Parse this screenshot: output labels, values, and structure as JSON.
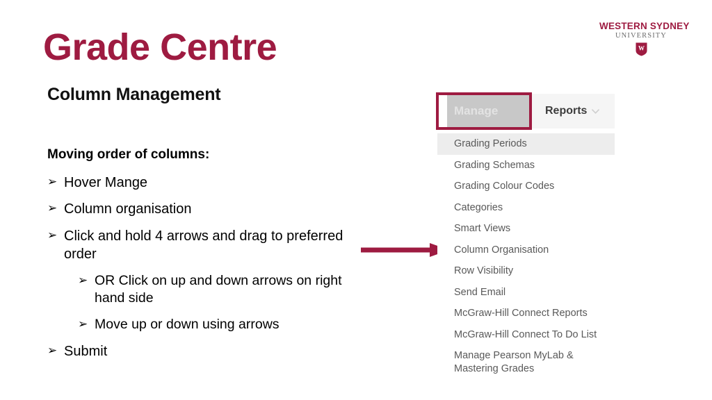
{
  "brand": {
    "line1": "WESTERN SYDNEY",
    "line2": "UNIVERSITY",
    "shield_letter": "W",
    "color": "#9E1B41"
  },
  "slide": {
    "title": "Grade Centre",
    "subtitle": "Column Management",
    "title_color": "#9E1B41"
  },
  "content": {
    "lead": "Moving order of columns:",
    "bullet_marker": "➢",
    "items": [
      {
        "level": 1,
        "text": "Hover Mange"
      },
      {
        "level": 1,
        "text": "Column organisation"
      },
      {
        "level": 1,
        "text": "Click and hold 4 arrows and drag to preferred order"
      },
      {
        "level": 2,
        "text": "OR Click on up and down arrows on right hand side"
      },
      {
        "level": 2,
        "text": " Move up or down using arrows"
      },
      {
        "level": 1,
        "text": "Submit"
      }
    ]
  },
  "annotation": {
    "arrow_color": "#9E1B41",
    "points_to": "Column Organisation"
  },
  "ui": {
    "tabs": [
      {
        "label": "Manage",
        "state": "active-highlighted",
        "bg": "#C8C8C8",
        "text_color": "#E3E3E3"
      },
      {
        "label": "Reports",
        "state": "default",
        "bg": "#F5F5F5",
        "text_color": "#3D3D3D"
      }
    ],
    "reports_chevron": "chevron-down",
    "highlight_border_color": "#9E1B41",
    "menu_items": [
      {
        "label": "Grading Periods",
        "highlighted": true
      },
      {
        "label": "Grading Schemas",
        "highlighted": false
      },
      {
        "label": "Grading Colour Codes",
        "highlighted": false
      },
      {
        "label": "Categories",
        "highlighted": false
      },
      {
        "label": "Smart Views",
        "highlighted": false
      },
      {
        "label": "Column Organisation",
        "highlighted": false
      },
      {
        "label": "Row Visibility",
        "highlighted": false
      },
      {
        "label": "Send Email",
        "highlighted": false
      },
      {
        "label": "McGraw-Hill Connect Reports",
        "highlighted": false
      },
      {
        "label": "McGraw-Hill Connect To Do List",
        "highlighted": false
      },
      {
        "label": "Manage Pearson MyLab & Mastering Grades",
        "highlighted": false
      }
    ]
  }
}
